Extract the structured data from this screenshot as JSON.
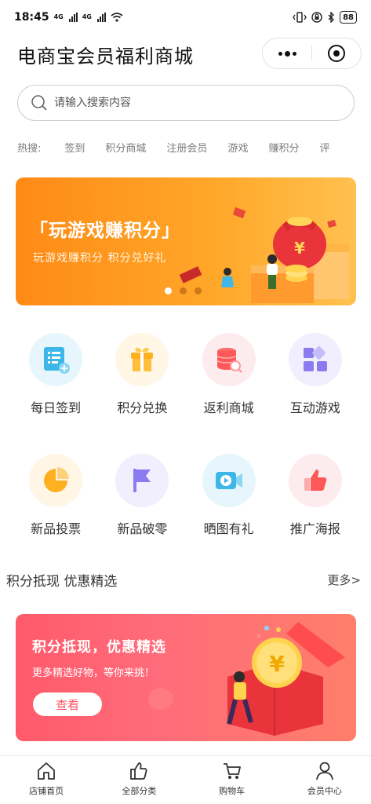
{
  "status_bar": {
    "time": "18:45",
    "net1": "4G",
    "net2": "4G",
    "battery": "88"
  },
  "nav": {
    "title": "电商宝会员福利商城"
  },
  "search": {
    "placeholder": "请输入搜索内容"
  },
  "hot": {
    "label": "热搜:",
    "keywords": [
      "签到",
      "积分商城",
      "注册会员",
      "游戏",
      "赚积分",
      "评"
    ]
  },
  "banner": {
    "headline": "「玩游戏赚积分」",
    "subtitle": "玩游戏赚积分  积分兑好礼",
    "coin_symbol": "¥",
    "slide_count": 3,
    "active_slide": 1
  },
  "grid": {
    "row1": [
      {
        "label": "每日签到",
        "icon": "checklist-icon",
        "bg": "#e6f6fc"
      },
      {
        "label": "积分兑换",
        "icon": "gift-icon",
        "bg": "#fff6e6"
      },
      {
        "label": "返利商城",
        "icon": "database-search-icon",
        "bg": "#fdeced"
      },
      {
        "label": "互动游戏",
        "icon": "apps-grid-icon",
        "bg": "#f1eefd"
      }
    ],
    "row2": [
      {
        "label": "新品投票",
        "icon": "pie-chart-icon",
        "bg": "#fff6e6"
      },
      {
        "label": "新品破零",
        "icon": "flag-icon",
        "bg": "#f1eefd"
      },
      {
        "label": "晒图有礼",
        "icon": "video-icon",
        "bg": "#e6f6fc"
      },
      {
        "label": "推广海报",
        "icon": "thumbs-up-icon",
        "bg": "#fdeced"
      }
    ]
  },
  "section": {
    "title": "积分抵现 优惠精选",
    "more": "更多>"
  },
  "promo": {
    "headline": "积分抵现，优惠精选",
    "subtitle": "更多精选好物，等你来挑！",
    "button": "查看",
    "coin_symbol": "¥"
  },
  "tabbar": [
    {
      "label": "店铺首页",
      "icon": "home-icon"
    },
    {
      "label": "全部分类",
      "icon": "thumbs-up-icon"
    },
    {
      "label": "购物车",
      "icon": "cart-icon"
    },
    {
      "label": "会员中心",
      "icon": "user-icon"
    }
  ],
  "colors": {
    "banner_orange": "#ff9a1f",
    "promo_red": "#ff5a6a",
    "accent_blue": "#3fb6e8"
  }
}
